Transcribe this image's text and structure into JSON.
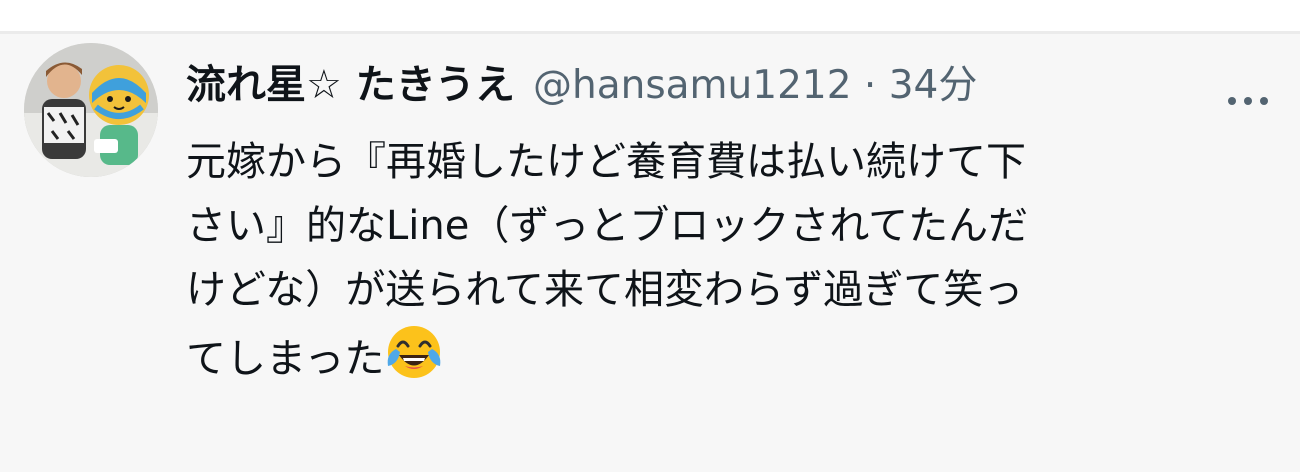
{
  "tweet": {
    "author": {
      "display_name": "流れ星☆ たきうえ",
      "handle": "@hansamu1212",
      "separator": "·",
      "time": "34分"
    },
    "text_lines": [
      "元嫁から『再婚したけど養育費は払い続けて下",
      "さい』的なLine（ずっとブロックされてたんだ",
      "けどな）が送られて来て相変わらず過ぎて笑っ",
      "てしまった"
    ],
    "emoji": "face-with-tears-of-joy-icon",
    "more_icon": "more-horizontal-icon",
    "colors": {
      "background": "#f7f7f7",
      "text": "#0f1419",
      "secondary": "#536471",
      "divider": "#ebebeb"
    }
  }
}
